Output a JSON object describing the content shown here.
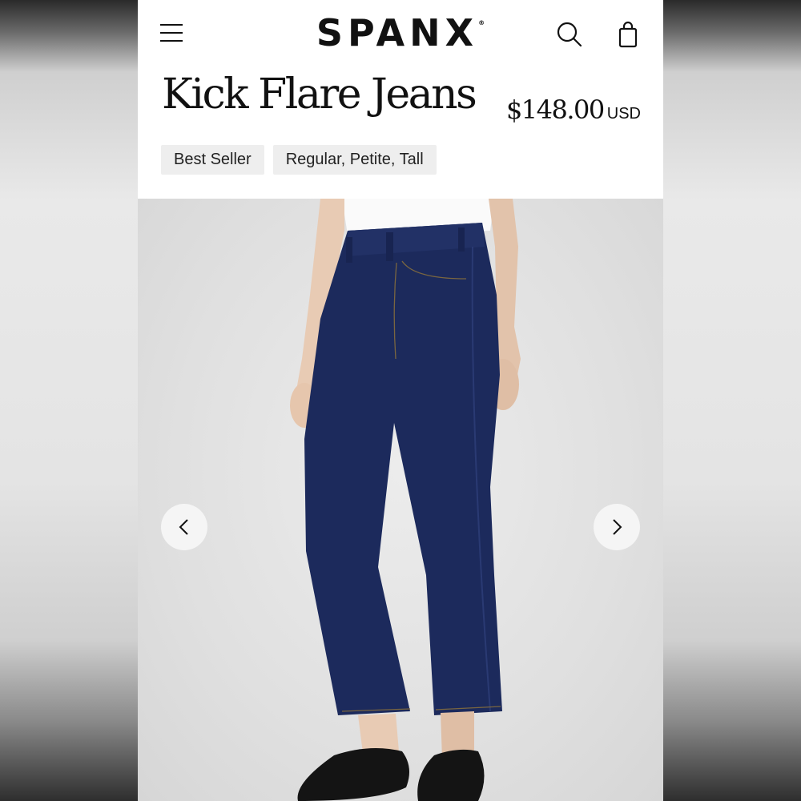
{
  "header": {
    "brand": "SPANX",
    "registered_mark": "®"
  },
  "product": {
    "title": "Kick Flare Jeans",
    "price": "$148.00",
    "currency": "USD",
    "badges": [
      "Best Seller",
      "Regular, Petite, Tall"
    ]
  },
  "gallery": {
    "icons": {
      "prev": "chevron-left-icon",
      "next": "chevron-right-icon"
    }
  },
  "colors": {
    "denim": "#1c2a5c",
    "shoe": "#141414",
    "badge_bg": "#eeeeee",
    "text": "#111111"
  }
}
